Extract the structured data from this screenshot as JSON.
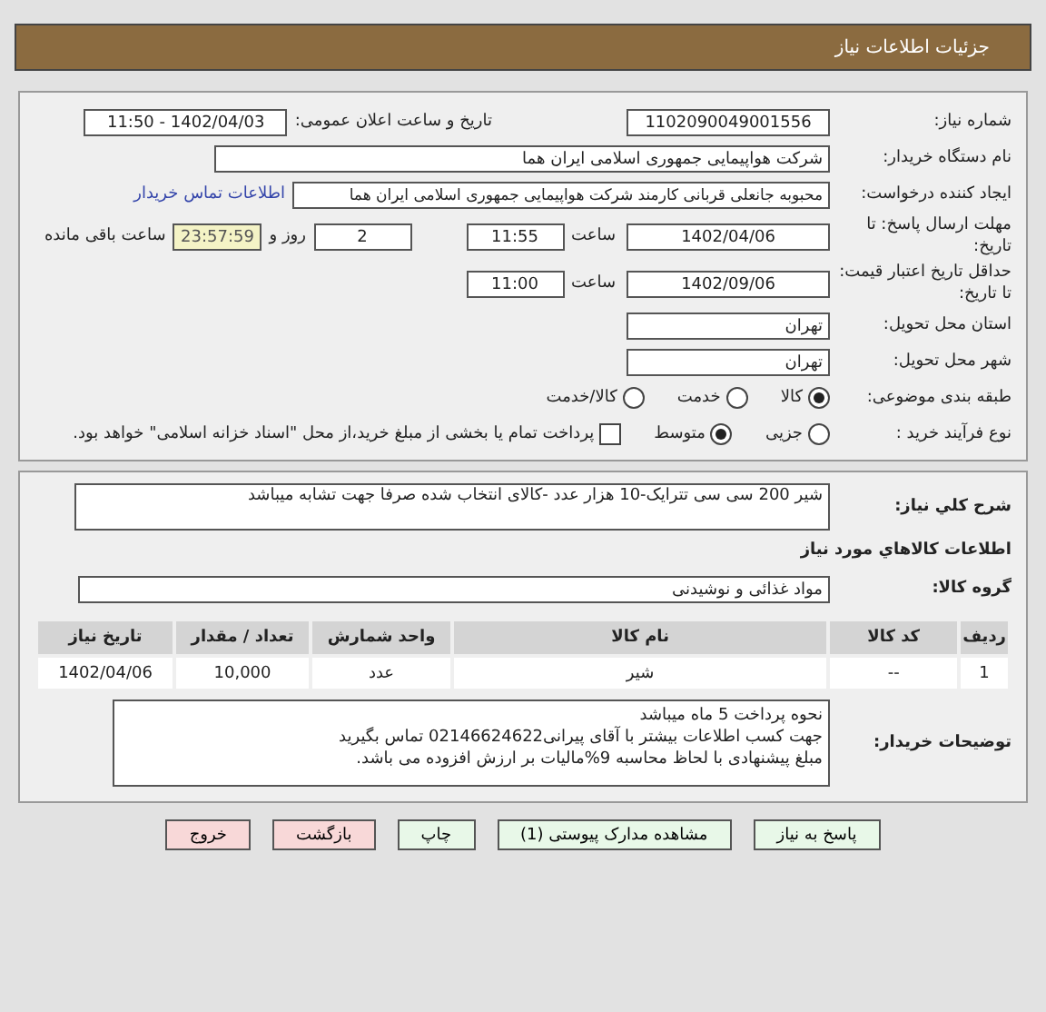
{
  "title": "جزئیات اطلاعات نیاز",
  "need_number": {
    "label": "شماره نیاز:",
    "value": "1102090049001556"
  },
  "announce": {
    "label": "تاریخ و ساعت اعلان عمومی:",
    "value": "1402/04/03 - 11:50"
  },
  "buyer": {
    "label": "نام دستگاه خریدار:",
    "value": "شرکت هواپیمایی جمهوری اسلامی ایران هما"
  },
  "creator": {
    "label": "ایجاد کننده درخواست:",
    "value": "محبوبه جانعلی قربانی کارمند شرکت هواپیمایی جمهوری اسلامی ایران هما",
    "link": "اطلاعات تماس خریدار"
  },
  "deadline": {
    "label": "مهلت ارسال پاسخ: تا تاریخ:",
    "date": "1402/04/06",
    "time_label": "ساعت",
    "time": "11:55",
    "days": "2",
    "days_label": "روز و",
    "remaining": "23:57:59",
    "remaining_label": "ساعت باقی مانده"
  },
  "validity": {
    "label": "حداقل تاریخ اعتبار قیمت: تا تاریخ:",
    "date": "1402/09/06",
    "time_label": "ساعت",
    "time": "11:00"
  },
  "province": {
    "label": "استان محل تحویل:",
    "value": "تهران"
  },
  "city": {
    "label": "شهر محل تحویل:",
    "value": "تهران"
  },
  "category": {
    "label": "طبقه بندی موضوعی:",
    "options": [
      {
        "label": "کالا",
        "selected": true
      },
      {
        "label": "خدمت",
        "selected": false
      },
      {
        "label": "کالا/خدمت",
        "selected": false
      }
    ]
  },
  "purchase_type": {
    "label": "نوع فرآیند خرید :",
    "options": [
      {
        "label": "جزیی",
        "selected": false
      },
      {
        "label": "متوسط",
        "selected": true
      }
    ],
    "checkbox": {
      "checked": false,
      "label": "پرداخت تمام یا بخشی از مبلغ خرید،از محل \"اسناد خزانه اسلامی\" خواهد بود."
    }
  },
  "description": {
    "label": "شرح کلي نياز:",
    "value": "شیر 200 سی سی تترایک-10 هزار عدد -کالای انتخاب شده صرفا جهت تشابه میباشد"
  },
  "items_heading": "اطلاعات کالاهاي مورد نياز",
  "group": {
    "label": "گروه کالا:",
    "value": "مواد غذائی و نوشیدنی"
  },
  "table": {
    "columns": [
      "ردیف",
      "کد کالا",
      "نام کالا",
      "واحد شمارش",
      "تعداد / مقدار",
      "تاریخ نیاز"
    ],
    "rows": [
      [
        "1",
        "--",
        "شیر",
        "عدد",
        "10,000",
        "1402/04/06"
      ]
    ]
  },
  "notes": {
    "label": "توضیحات خریدار:",
    "lines": [
      "نحوه پرداخت 5 ماه میباشد",
      "جهت کسب اطلاعات بیشتر با آقای پیرانی02146624622 تماس بگیرید",
      "مبلغ پیشنهادی با لحاظ محاسبه 9%مالیات بر ارزش افزوده می باشد."
    ]
  },
  "buttons": [
    {
      "label": "پاسخ به نیاز",
      "kind": "green"
    },
    {
      "label": "مشاهده مدارک پیوستی (1)",
      "kind": "green"
    },
    {
      "label": "چاپ",
      "kind": "green"
    },
    {
      "label": "بازگشت",
      "kind": "red"
    },
    {
      "label": "خروج",
      "kind": "red"
    }
  ]
}
